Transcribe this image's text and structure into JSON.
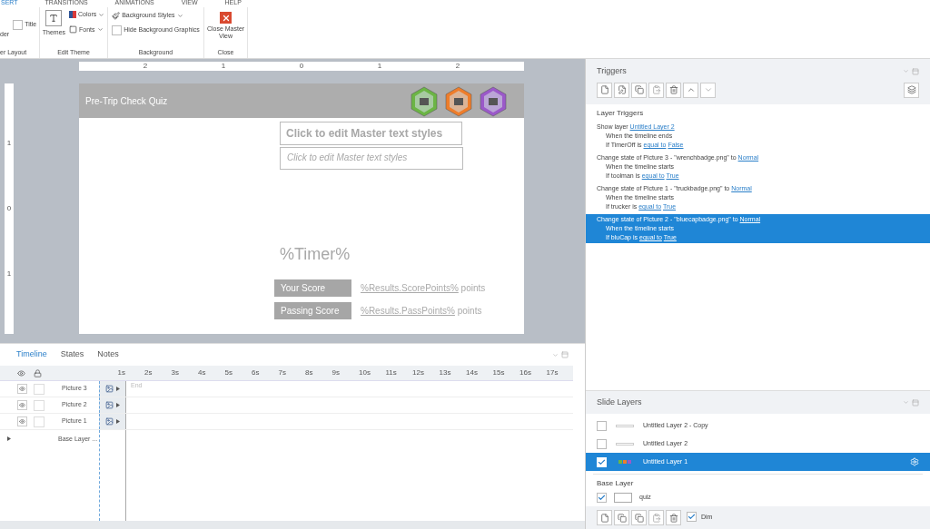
{
  "ribbon": {
    "tabs": [
      {
        "label": "SERT",
        "selected": true
      },
      {
        "label": "TRANSITIONS",
        "selected": false
      },
      {
        "label": "ANIMATIONS",
        "selected": false
      },
      {
        "label": "VIEW",
        "selected": false
      },
      {
        "label": "HELP",
        "selected": false
      }
    ],
    "layout_group": {
      "button": "der",
      "title_checkbox": {
        "label": "Title",
        "checked": false
      },
      "label": "er Layout"
    },
    "theme_group": {
      "themes": "Themes",
      "colors": "Colors",
      "fonts": "Fonts",
      "label": "Edit Theme"
    },
    "background_group": {
      "styles": "Background Styles",
      "hide": {
        "label": "Hide Background Graphics",
        "checked": false
      },
      "label": "Background"
    },
    "close_group": {
      "button": "Close Master View",
      "label": "Close"
    }
  },
  "rulers": {
    "horizontal": [
      "2",
      "1",
      "0",
      "1",
      "2"
    ],
    "vertical": [
      "1",
      "0",
      "1"
    ]
  },
  "slide": {
    "title": "Pre-Trip Check Quiz",
    "badges": [
      {
        "color": "#6cb545"
      },
      {
        "color": "#ee7d2b"
      },
      {
        "color": "#9b59c9"
      }
    ],
    "title_placeholder": "Click to edit Master text styles",
    "body_placeholder": "Click to edit Master text styles",
    "timer": "%Timer%",
    "scores": [
      {
        "label": "Your Score",
        "variable": "%Results.ScorePoints%",
        "unit": "points"
      },
      {
        "label": "Passing Score",
        "variable": "%Results.PassPoints%",
        "unit": "points"
      }
    ]
  },
  "timeline": {
    "tabs": [
      {
        "label": "Timeline",
        "selected": true
      },
      {
        "label": "States",
        "selected": false
      },
      {
        "label": "Notes",
        "selected": false
      }
    ],
    "ticks": [
      "1s",
      "2s",
      "3s",
      "4s",
      "5s",
      "6s",
      "7s",
      "8s",
      "9s",
      "10s",
      "11s",
      "12s",
      "13s",
      "14s",
      "15s",
      "16s",
      "17s"
    ],
    "end_label": "End",
    "rows": [
      {
        "name": "Picture 3",
        "visible": true,
        "locked": false
      },
      {
        "name": "Picture 2",
        "visible": true,
        "locked": false
      },
      {
        "name": "Picture 1",
        "visible": true,
        "locked": false
      }
    ],
    "base_row": "Base Layer ..."
  },
  "triggers": {
    "title": "Triggers",
    "section": "Layer Triggers",
    "items": [
      {
        "selected": false,
        "lines": [
          {
            "text": "Show layer",
            "links": [
              "Untitled Layer 2"
            ]
          },
          {
            "text": "When the timeline ends"
          },
          {
            "text": "If TimerOff is",
            "links": [
              "equal to",
              "False"
            ]
          }
        ]
      },
      {
        "selected": false,
        "lines": [
          {
            "text": "Change state of Picture 3 - \"wrenchbadge.png\" to",
            "links": [
              "Normal"
            ]
          },
          {
            "text": "When the timeline starts"
          },
          {
            "text": "If toolman is",
            "links": [
              "equal to",
              "True"
            ]
          }
        ]
      },
      {
        "selected": false,
        "lines": [
          {
            "text": "Change state of Picture 1 - \"truckbadge.png\" to",
            "links": [
              "Normal"
            ]
          },
          {
            "text": "When the timeline starts"
          },
          {
            "text": "If trucker is",
            "links": [
              "equal to",
              "True"
            ]
          }
        ]
      },
      {
        "selected": true,
        "lines": [
          {
            "text": "Change state of Picture 2 - \"bluecapbadge.png\" to",
            "links": [
              "Normal"
            ]
          },
          {
            "text": "When the timeline starts"
          },
          {
            "text": "If bluCap is",
            "links": [
              "equal to",
              "True"
            ]
          }
        ]
      }
    ]
  },
  "slide_layers": {
    "title": "Slide Layers",
    "items": [
      {
        "name": "Untitled Layer 2 - Copy",
        "checked": false,
        "selected": false,
        "kind": "blank"
      },
      {
        "name": "Untitled Layer 2",
        "checked": false,
        "selected": false,
        "kind": "blank"
      },
      {
        "name": "Untitled Layer 1",
        "checked": true,
        "selected": true,
        "kind": "badges"
      }
    ],
    "base_title": "Base Layer",
    "base": {
      "name": "quiz",
      "checked": true
    },
    "dim": {
      "label": "Dim",
      "checked": true
    }
  }
}
